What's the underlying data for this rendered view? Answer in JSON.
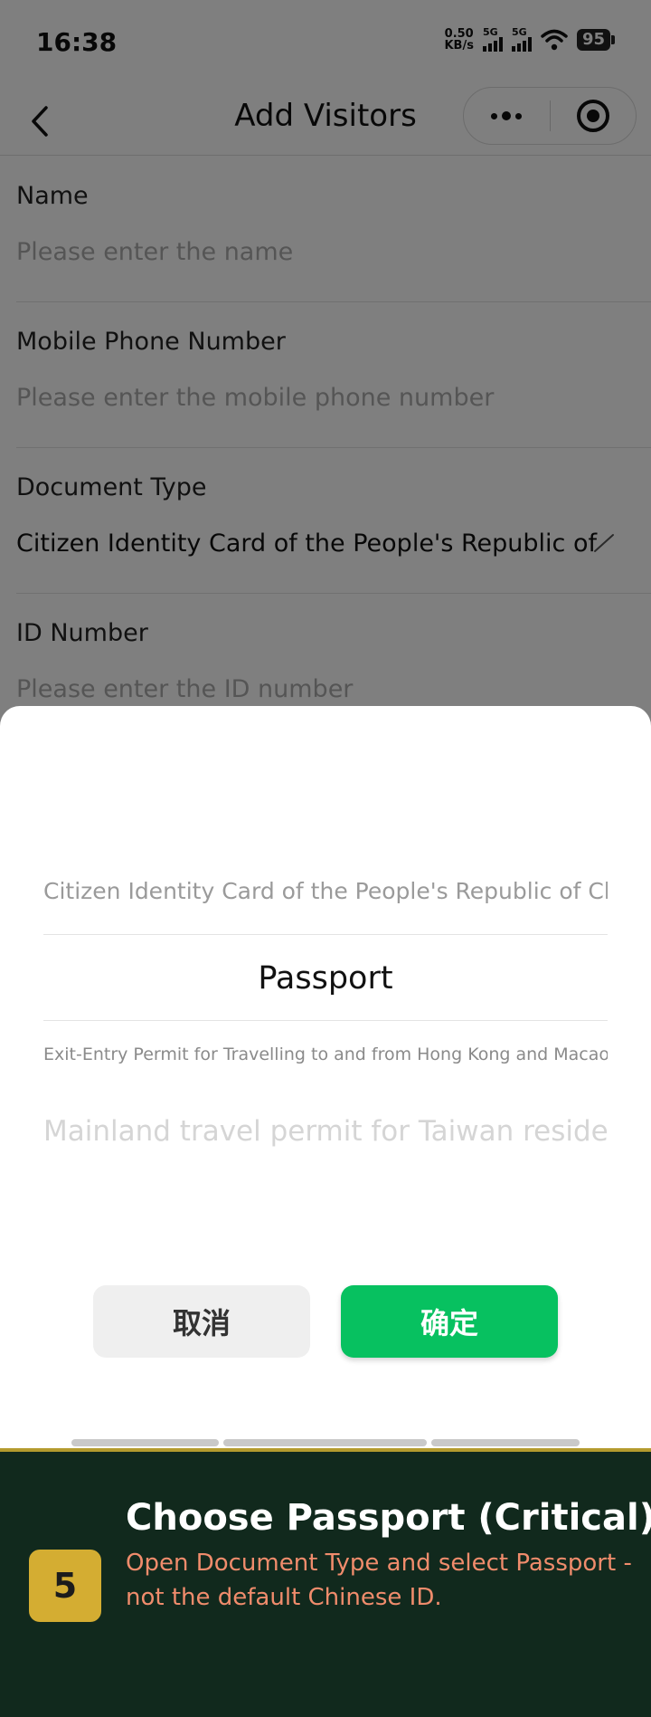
{
  "status_bar": {
    "time": "16:38",
    "net_speed_value": "0.50",
    "net_speed_unit": "KB/s",
    "signal_1": "5G",
    "signal_2": "5G",
    "battery": "95",
    "icons": [
      "signal-bars-icon",
      "wifi-icon",
      "battery-icon"
    ]
  },
  "nav": {
    "title": "Add Visitors",
    "icons": [
      "back-chevron-icon",
      "more-dots-icon",
      "target-icon"
    ]
  },
  "form": {
    "fields": [
      {
        "label": "Name",
        "placeholder": "Please enter the name"
      },
      {
        "label": "Mobile Phone Number",
        "placeholder": "Please enter the mobile phone number"
      },
      {
        "label": "Document Type",
        "value": "Citizen Identity Card of the People's Republic of Chin"
      },
      {
        "label": "ID Number",
        "placeholder": "Please enter the ID number"
      }
    ]
  },
  "picker": {
    "options": [
      "Citizen Identity Card of the People's Republic of China",
      "Passport",
      "Exit-Entry Permit for Travelling to and from Hong Kong and Macao",
      "Mainland travel permit for Taiwan residents"
    ],
    "selected": "Passport",
    "cancel_label": "取消",
    "confirm_label": "确定",
    "confirm_color": "#07c160"
  },
  "tutorial": {
    "step": "5",
    "title": "Choose Passport (Critical)",
    "text": "Open Document Type and select Passport - not the default Chinese ID.",
    "bg_color": "#11291d",
    "badge_color": "#d4ad32",
    "text_color": "#f08c6c"
  }
}
